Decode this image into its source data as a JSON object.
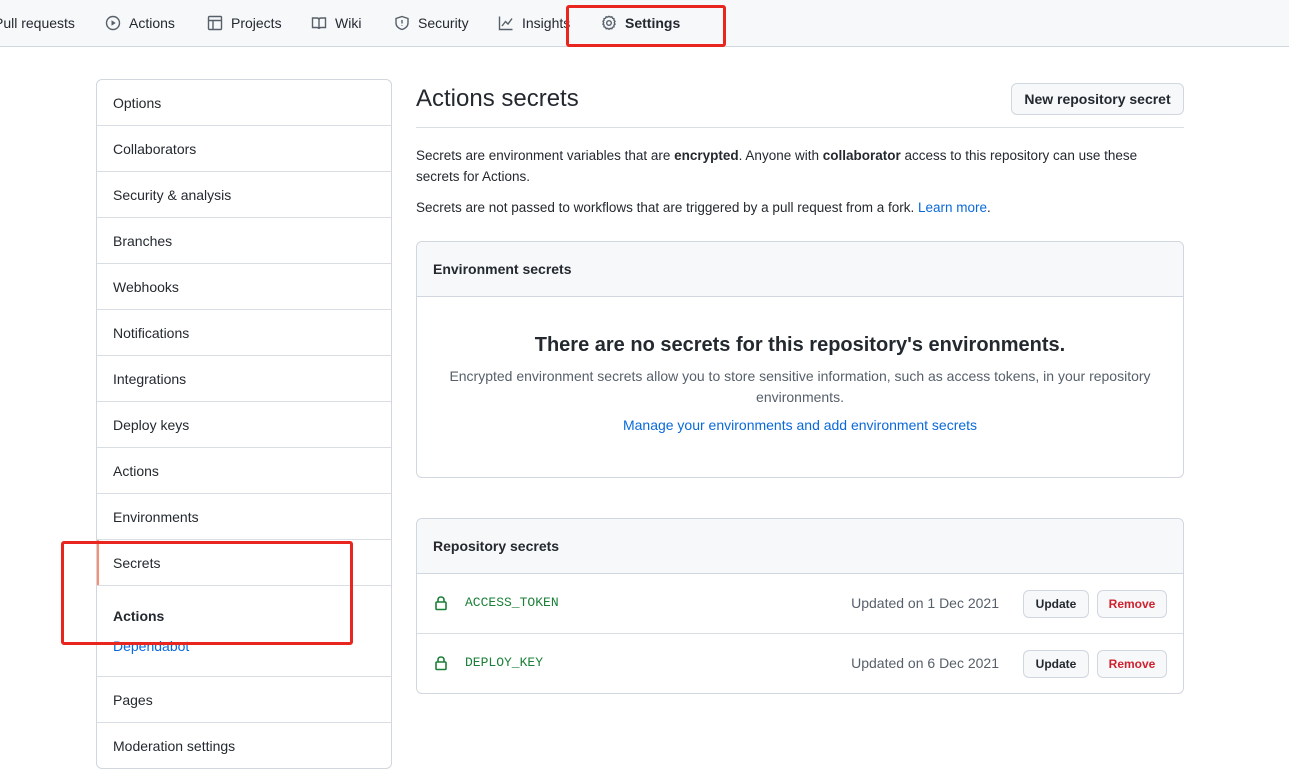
{
  "nav": {
    "tabs": [
      {
        "label": "Pull requests",
        "icon": "pull-request-icon"
      },
      {
        "label": "Actions",
        "icon": "play-icon"
      },
      {
        "label": "Projects",
        "icon": "project-icon"
      },
      {
        "label": "Wiki",
        "icon": "book-icon"
      },
      {
        "label": "Security",
        "icon": "shield-icon"
      },
      {
        "label": "Insights",
        "icon": "graph-icon"
      },
      {
        "label": "Settings",
        "icon": "gear-icon",
        "selected": true
      }
    ]
  },
  "sidebar": {
    "items": [
      {
        "label": "Options"
      },
      {
        "label": "Collaborators"
      },
      {
        "label": "Security & analysis"
      },
      {
        "label": "Branches"
      },
      {
        "label": "Webhooks"
      },
      {
        "label": "Notifications"
      },
      {
        "label": "Integrations"
      },
      {
        "label": "Deploy keys"
      },
      {
        "label": "Actions"
      },
      {
        "label": "Environments"
      },
      {
        "label": "Secrets",
        "selected": true
      }
    ],
    "secrets_sub": {
      "title": "Actions",
      "link": "Dependabot"
    },
    "bottom_items": [
      {
        "label": "Pages"
      },
      {
        "label": "Moderation settings"
      }
    ]
  },
  "main": {
    "title": "Actions secrets",
    "new_button": "New repository secret",
    "desc1_a": "Secrets are environment variables that are ",
    "desc1_b": "encrypted",
    "desc1_c": ". Anyone with ",
    "desc1_d": "collaborator",
    "desc1_e": " access to this repository can use these secrets for Actions.",
    "desc2_a": "Secrets are not passed to workflows that are triggered by a pull request from a fork. ",
    "desc2_link": "Learn more",
    "desc2_end": ".",
    "env": {
      "header": "Environment secrets",
      "blank_title": "There are no secrets for this repository's environments.",
      "blank_text": "Encrypted environment secrets allow you to store sensitive information, such as access tokens, in your repository environments.",
      "blank_link": "Manage your environments and add environment secrets"
    },
    "repo": {
      "header": "Repository secrets",
      "rows": [
        {
          "name": "ACCESS_TOKEN",
          "updated": "Updated on 1 Dec 2021",
          "update": "Update",
          "remove": "Remove"
        },
        {
          "name": "DEPLOY_KEY",
          "updated": "Updated on 6 Dec 2021",
          "update": "Update",
          "remove": "Remove"
        }
      ]
    }
  },
  "colors": {
    "link": "#0969da",
    "secret_green": "#1a7f37",
    "danger": "#cf222e",
    "selected_accent": "#fd8c73",
    "annotation_red": "#e8261f"
  }
}
